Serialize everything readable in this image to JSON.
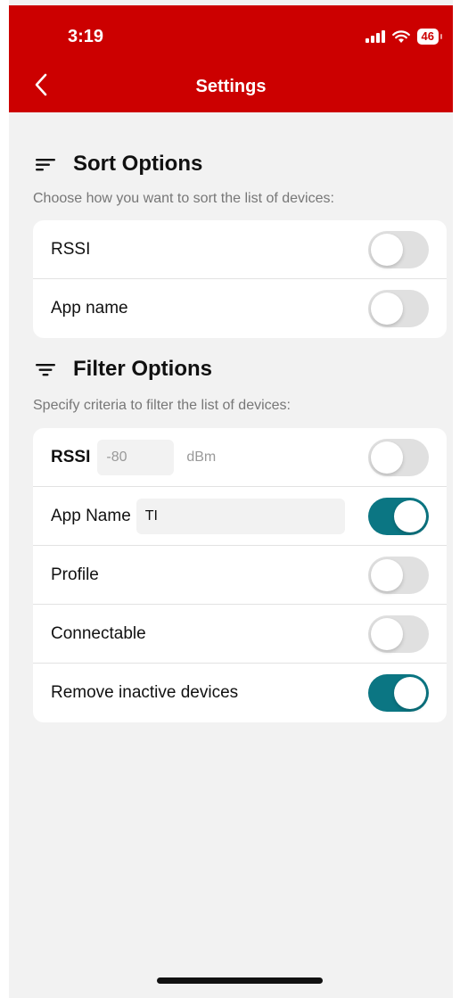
{
  "status_bar": {
    "time": "3:19",
    "battery": "46"
  },
  "header": {
    "title": "Settings"
  },
  "sort": {
    "title": "Sort Options",
    "description": "Choose how you want to sort the list of devices:",
    "items": [
      {
        "label": "RSSI",
        "enabled": false
      },
      {
        "label": "App name",
        "enabled": false
      }
    ]
  },
  "filter": {
    "title": "Filter Options",
    "description": "Specify criteria to filter the list of devices:",
    "rssi": {
      "label": "RSSI",
      "placeholder": "-80",
      "unit": "dBm",
      "enabled": false
    },
    "app_name": {
      "label": "App Name",
      "value": "TI",
      "enabled": true
    },
    "profile": {
      "label": "Profile",
      "enabled": false
    },
    "connectable": {
      "label": "Connectable",
      "enabled": false
    },
    "remove_inactive": {
      "label": "Remove inactive devices",
      "enabled": true
    }
  },
  "colors": {
    "header": "#cc0000",
    "toggle_on": "#0b7683",
    "background": "#f2f2f2"
  }
}
